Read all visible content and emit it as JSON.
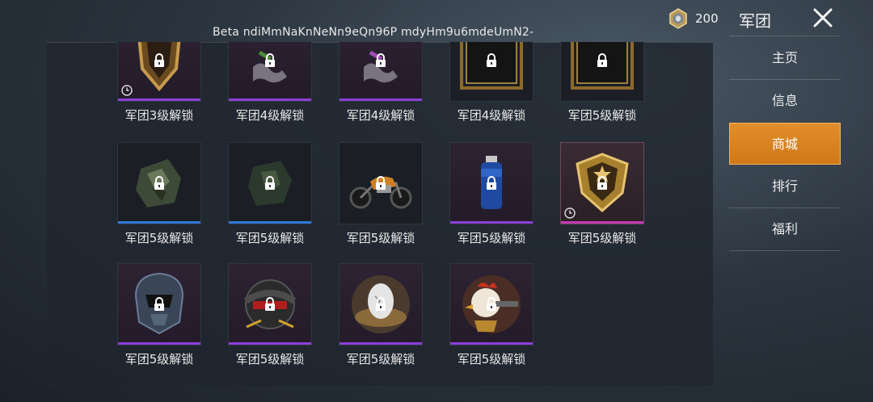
{
  "header": {
    "watermark": "Beta ndiMmNaKnNeNn9eQn96P mdyHm9u6mdeUmN2-",
    "currency_amount": "200",
    "currency_icon": "medal-coin-icon"
  },
  "sidebar": {
    "title": "军团",
    "close_icon": "close-icon",
    "items": [
      {
        "label": "主页",
        "active": false
      },
      {
        "label": "信息",
        "active": false
      },
      {
        "label": "商城",
        "active": true
      },
      {
        "label": "排行",
        "active": false
      },
      {
        "label": "福利",
        "active": false
      }
    ]
  },
  "shop": {
    "rows": [
      [
        {
          "label": "军团3级解锁",
          "rarity": "purple",
          "art": "shield-emblem",
          "timed": true
        },
        {
          "label": "军团4级解锁",
          "rarity": "purple",
          "art": "parachute-skeleton",
          "timed": false
        },
        {
          "label": "军团4级解锁",
          "rarity": "purple",
          "art": "parachute-skeleton",
          "timed": false
        },
        {
          "label": "军团4级解锁",
          "rarity": "none",
          "art": "gold-frame",
          "timed": false
        },
        {
          "label": "军团5级解锁",
          "rarity": "none",
          "art": "gold-frame",
          "timed": false
        }
      ],
      [
        {
          "label": "军团5级解锁",
          "rarity": "blue",
          "art": "camo-patch",
          "timed": false
        },
        {
          "label": "军团5级解锁",
          "rarity": "blue",
          "art": "camo-patch",
          "timed": false
        },
        {
          "label": "军团5级解锁",
          "rarity": "none",
          "art": "motorcycle",
          "timed": false
        },
        {
          "label": "军团5级解锁",
          "rarity": "purple",
          "art": "spray-can",
          "timed": false
        },
        {
          "label": "军团5级解锁",
          "rarity": "pink",
          "art": "gold-shield-star",
          "timed": true
        }
      ],
      [
        {
          "label": "军团5级解锁",
          "rarity": "purple",
          "art": "helmet-mask",
          "timed": false
        },
        {
          "label": "军团5级解锁",
          "rarity": "purple",
          "art": "helmet-goggles",
          "timed": false
        },
        {
          "label": "军团5级解锁",
          "rarity": "purple",
          "art": "egg-nest",
          "timed": false
        },
        {
          "label": "军团5级解锁",
          "rarity": "purple",
          "art": "rooster-gunner",
          "timed": false
        }
      ]
    ]
  }
}
